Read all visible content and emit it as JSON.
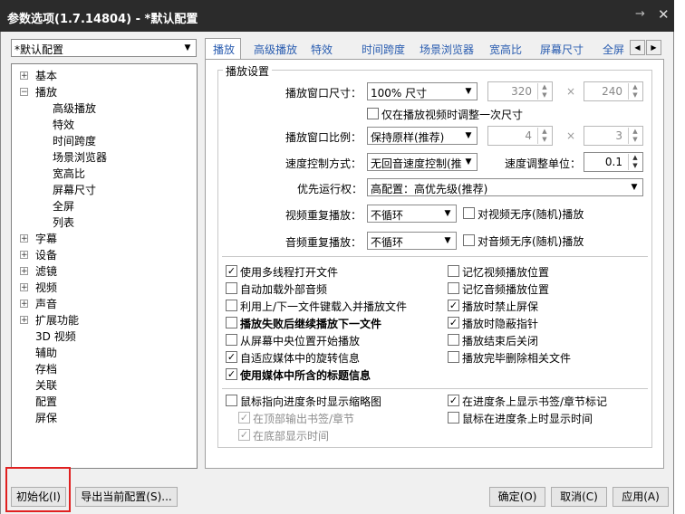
{
  "window": {
    "title": "参数选项(1.7.14804) - *默认配置"
  },
  "profile": {
    "selected": "*默认配置"
  },
  "tree": {
    "items": [
      {
        "label": "基本",
        "expander": "+"
      },
      {
        "label": "播放",
        "expander": "−"
      },
      {
        "label": "高级播放"
      },
      {
        "label": "特效"
      },
      {
        "label": "时间跨度"
      },
      {
        "label": "场景浏览器"
      },
      {
        "label": "宽高比"
      },
      {
        "label": "屏幕尺寸"
      },
      {
        "label": "全屏"
      },
      {
        "label": "列表"
      },
      {
        "label": "字幕",
        "expander": "+"
      },
      {
        "label": "设备",
        "expander": "+"
      },
      {
        "label": "滤镜",
        "expander": "+"
      },
      {
        "label": "视频",
        "expander": "+"
      },
      {
        "label": "声音",
        "expander": "+"
      },
      {
        "label": "扩展功能",
        "expander": "+"
      },
      {
        "label": "3D 视频"
      },
      {
        "label": "辅助"
      },
      {
        "label": "存档"
      },
      {
        "label": "关联"
      },
      {
        "label": "配置"
      },
      {
        "label": "屏保"
      }
    ]
  },
  "tabs": [
    "播放",
    "高级播放",
    "特效",
    "时间跨度",
    "场景浏览器",
    "宽高比",
    "屏幕尺寸",
    "全屏"
  ],
  "group": {
    "title": "播放设置"
  },
  "form": {
    "window_size_label": "播放窗口尺寸：",
    "window_size_value": "100% 尺寸",
    "width": "320",
    "height": "240",
    "times": "×",
    "adjust_once": "仅在播放视频时调整一次尺寸",
    "ratio_label": "播放窗口比例：",
    "ratio_value": "保持原样(推荐)",
    "ratio_w": "4",
    "ratio_h": "3",
    "speed_mode_label": "速度控制方式：",
    "speed_mode_value": "无回音速度控制(推",
    "speed_unit_label": "速度调整单位：",
    "speed_unit_value": "0.1",
    "priority_label": "优先运行权：",
    "priority_value": "高配置：高优先级(推荐)",
    "video_repeat_label": "视频重复播放：",
    "video_repeat_value": "不循环",
    "video_shuffle": "对视频无序(随机)播放",
    "audio_repeat_label": "音频重复播放：",
    "audio_repeat_value": "不循环",
    "audio_shuffle": "对音频无序(随机)播放"
  },
  "checks_left": [
    {
      "label": "使用多线程打开文件",
      "checked": true,
      "bold": false
    },
    {
      "label": "自动加载外部音频",
      "checked": false,
      "bold": false
    },
    {
      "label": "利用上/下一文件键载入并播放文件",
      "checked": false,
      "bold": false
    },
    {
      "label": "播放失败后继续播放下一文件",
      "checked": false,
      "bold": true
    },
    {
      "label": "从屏幕中央位置开始播放",
      "checked": false,
      "bold": false
    },
    {
      "label": "自适应媒体中的旋转信息",
      "checked": true,
      "bold": false
    },
    {
      "label": "使用媒体中所含的标题信息",
      "checked": true,
      "bold": true
    }
  ],
  "checks_right": [
    {
      "label": "记忆视频播放位置",
      "checked": false
    },
    {
      "label": "记忆音频播放位置",
      "checked": false
    },
    {
      "label": "播放时禁止屏保",
      "checked": true
    },
    {
      "label": "播放时隐蔽指针",
      "checked": true
    },
    {
      "label": "播放结束后关闭",
      "checked": false
    },
    {
      "label": "播放完毕删除相关文件",
      "checked": false
    }
  ],
  "seek": {
    "thumbnail": "鼠标指向进度条时显示缩略图",
    "top_output": "在顶部输出书签/章节",
    "bottom_time": "在底部显示时间",
    "show_bookmarks": "在进度条上显示书签/章节标记",
    "show_time": "鼠标在进度条上时显示时间"
  },
  "buttons": {
    "init": "初始化(I)",
    "export": "导出当前配置(S)...",
    "ok": "确定(O)",
    "cancel": "取消(C)",
    "apply": "应用(A)"
  },
  "icons": {
    "pin": "pin-icon",
    "close": "close-icon"
  },
  "colors": {
    "highlight_box": "#e02020",
    "titlebar": "#2b2b2b"
  }
}
